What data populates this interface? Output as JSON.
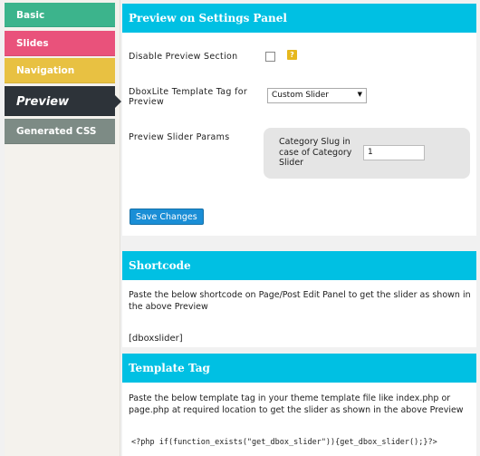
{
  "sidebar": {
    "tabs": [
      {
        "label": "Basic"
      },
      {
        "label": "Slides"
      },
      {
        "label": "Navigation"
      },
      {
        "label": "Preview"
      },
      {
        "label": "Generated CSS"
      }
    ]
  },
  "preview_panel": {
    "title": "Preview on Settings Panel",
    "disable_label": "Disable Preview Section",
    "help_symbol": "?",
    "template_tag_label": "DboxLite Template Tag for Preview",
    "template_tag_value": "Custom Slider",
    "params_label": "Preview Slider Params",
    "category_label": "Category Slug in case of Category Slider",
    "category_value": "1",
    "save_label": "Save Changes"
  },
  "shortcode_panel": {
    "title": "Shortcode",
    "description": "Paste the below shortcode on Page/Post Edit Panel to get the slider as shown in the above Preview",
    "shortcode": "[dboxslider]"
  },
  "template_panel": {
    "title": "Template Tag",
    "description": "Paste the below template tag in your theme template file like index.php or page.php at required location to get the slider as shown in the above Preview",
    "code": "<?php if(function_exists(\"get_dbox_slider\")){get_dbox_slider();}?>"
  },
  "colors": {
    "basic": "#3cb48c",
    "slides": "#e9527b",
    "navigation": "#e8c142",
    "preview": "#2d3339",
    "generated_css": "#7d8b85",
    "header": "#00c0e3",
    "button": "#1a8ed6"
  }
}
